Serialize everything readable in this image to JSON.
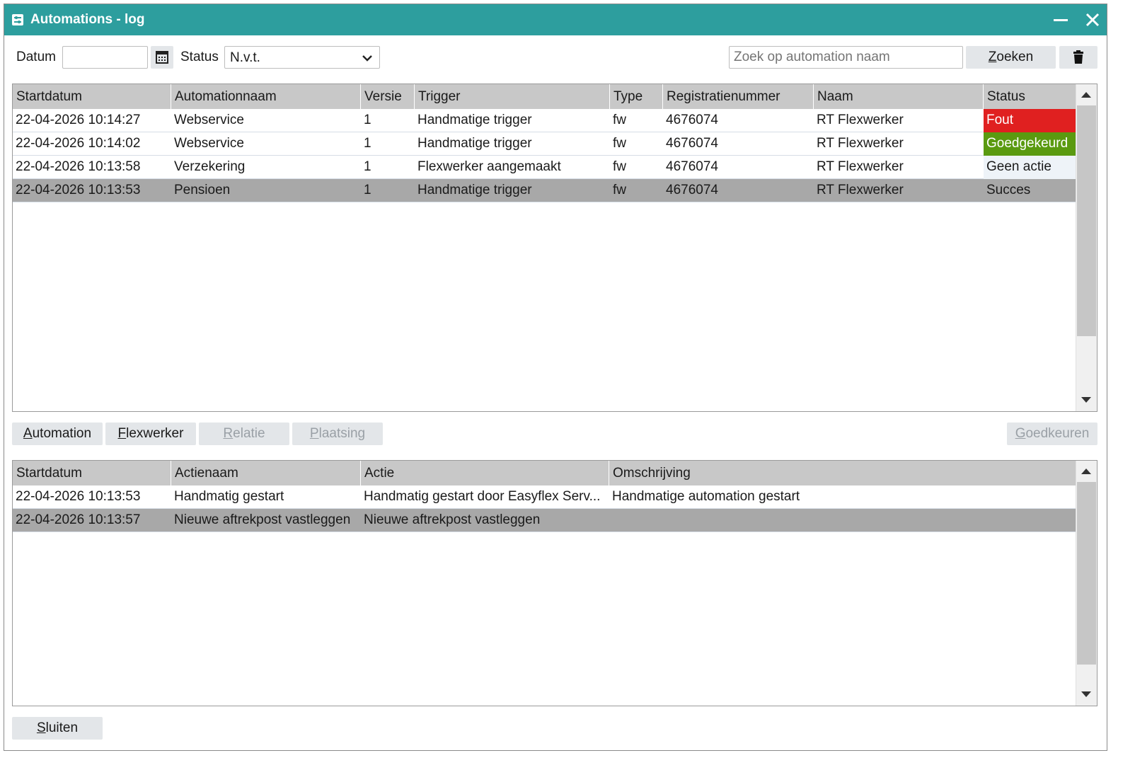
{
  "window": {
    "title": "Automations - log"
  },
  "filters": {
    "datum_label": "Datum",
    "datum_value": "",
    "status_label": "Status",
    "status_value": "N.v.t.",
    "search_placeholder": "Zoek op automation naam",
    "search_value": "",
    "search_button": {
      "underline": "Z",
      "rest": "oeken"
    }
  },
  "automations_table": {
    "columns": [
      "Startdatum",
      "Automationnaam",
      "Versie",
      "Trigger",
      "Type",
      "Registratienummer",
      "Naam",
      "Status"
    ],
    "rows": [
      [
        "22-04-2026 10:14:27",
        "Webservice",
        "1",
        "Handmatige trigger",
        "fw",
        "4676074",
        "RT Flexwerker",
        "Fout"
      ],
      [
        "22-04-2026 10:14:02",
        "Webservice",
        "1",
        "Handmatige trigger",
        "fw",
        "4676074",
        "RT Flexwerker",
        "Goedgekeurd"
      ],
      [
        "22-04-2026 10:13:58",
        "Verzekering",
        "1",
        "Flexwerker aangemaakt",
        "fw",
        "4676074",
        "RT Flexwerker",
        "Geen actie"
      ],
      [
        "22-04-2026 10:13:53",
        "Pensioen",
        "1",
        "Handmatige trigger",
        "fw",
        "4676074",
        "RT Flexwerker",
        "Succes"
      ]
    ],
    "selected_row": 3,
    "status_colors": {
      "Fout": "#e02020",
      "Goedgekeurd": "#5a9a10"
    }
  },
  "tabs": {
    "automation": {
      "underline": "A",
      "rest": "utomation",
      "enabled": true
    },
    "flexwerker": {
      "underline": "F",
      "rest": "lexwerker",
      "enabled": true
    },
    "relatie": {
      "underline": "R",
      "rest": "elatie",
      "enabled": false
    },
    "plaatsing": {
      "underline": "P",
      "rest": "laatsing",
      "enabled": false
    },
    "goedkeuren": {
      "underline": "G",
      "rest": "oedkeuren",
      "enabled": false
    }
  },
  "actions_table": {
    "columns": [
      "Startdatum",
      "Actienaam",
      "Actie",
      "Omschrijving"
    ],
    "rows": [
      [
        "22-04-2026 10:13:53",
        "Handmatig gestart",
        "Handmatig gestart door Easyflex Serv...",
        "Handmatige automation gestart"
      ],
      [
        "22-04-2026 10:13:57",
        "Nieuwe aftrekpost vastleggen",
        "Nieuwe aftrekpost vastleggen",
        ""
      ]
    ],
    "selected_row": 1
  },
  "close_button": {
    "underline": "S",
    "rest": "luiten"
  },
  "colors": {
    "titlebar": "#2d9e9e",
    "header": "#c8c8c8",
    "selected": "#a8a8a8",
    "button": "#e3e6e9"
  }
}
